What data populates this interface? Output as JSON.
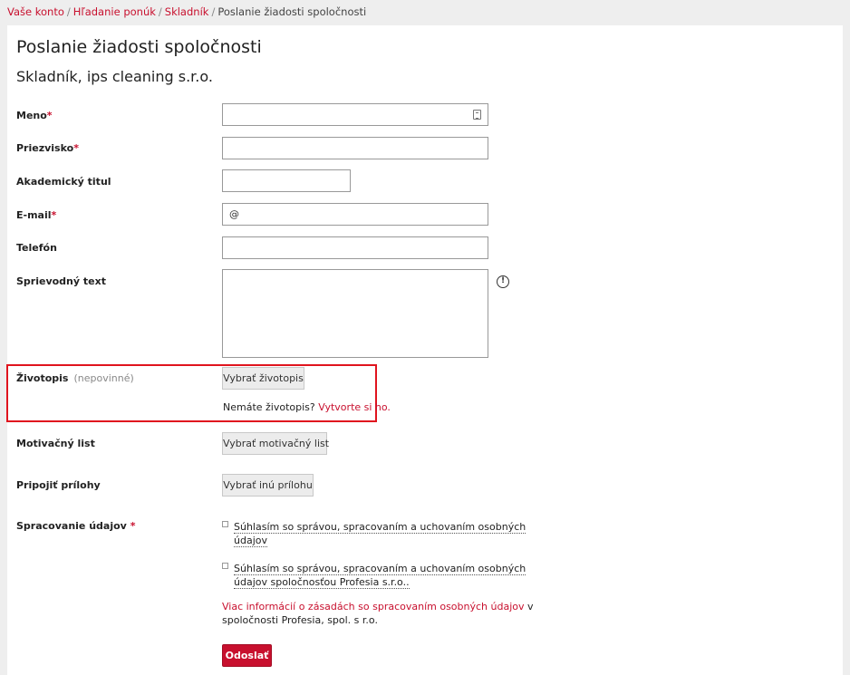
{
  "breadcrumb": {
    "items": [
      "Vaše konto",
      "Hľadanie ponúk",
      "Skladník"
    ],
    "current": "Poslanie žiadosti spoločnosti"
  },
  "page": {
    "title": "Poslanie žiadosti spoločnosti",
    "subtitle": "Skladník, ips cleaning s.r.o."
  },
  "form": {
    "first_name": {
      "label": "Meno",
      "required": "*",
      "value": ""
    },
    "last_name": {
      "label": "Priezvisko",
      "required": "*",
      "value": ""
    },
    "academic_title": {
      "label": "Akademický titul",
      "value": ""
    },
    "email": {
      "label": "E-mail",
      "required": "*",
      "prefix": "@"
    },
    "phone": {
      "label": "Telefón",
      "value": ""
    },
    "cover_text": {
      "label": "Sprievodný text",
      "value": ""
    },
    "cv": {
      "label": "Životopis",
      "optional": "(nepovinné)",
      "button": "Vybrať životopis",
      "no_cv_text": "Nemáte životopis?",
      "create_link": "Vytvorte si ho."
    },
    "motivation_letter": {
      "label": "Motivačný list",
      "button": "Vybrať motivačný list"
    },
    "attachments": {
      "label": "Pripojiť prílohy",
      "button": "Vybrať inú prílohu"
    },
    "data_processing": {
      "label": "Spracovanie údajov",
      "required": "*",
      "consent1_line1": "Súhlasím so správou, spracovaním a uchovaním osobných",
      "consent1_line2": "údajov",
      "consent2_line1": "Súhlasím so správou, spracovaním a uchovaním osobných",
      "consent2_line2": "údajov spoločnosťou Profesia s.r.o..",
      "info_link": "Viac informácií o zásadách so spracovaním osobných údajov",
      "info_suffix": " v",
      "info_line2": "spoločnosti Profesia, spol. s r.o."
    },
    "submit": "Odoslať"
  },
  "colors": {
    "accent": "#c8102e",
    "highlight_border": "#e0141e",
    "background": "#eeeeee"
  }
}
